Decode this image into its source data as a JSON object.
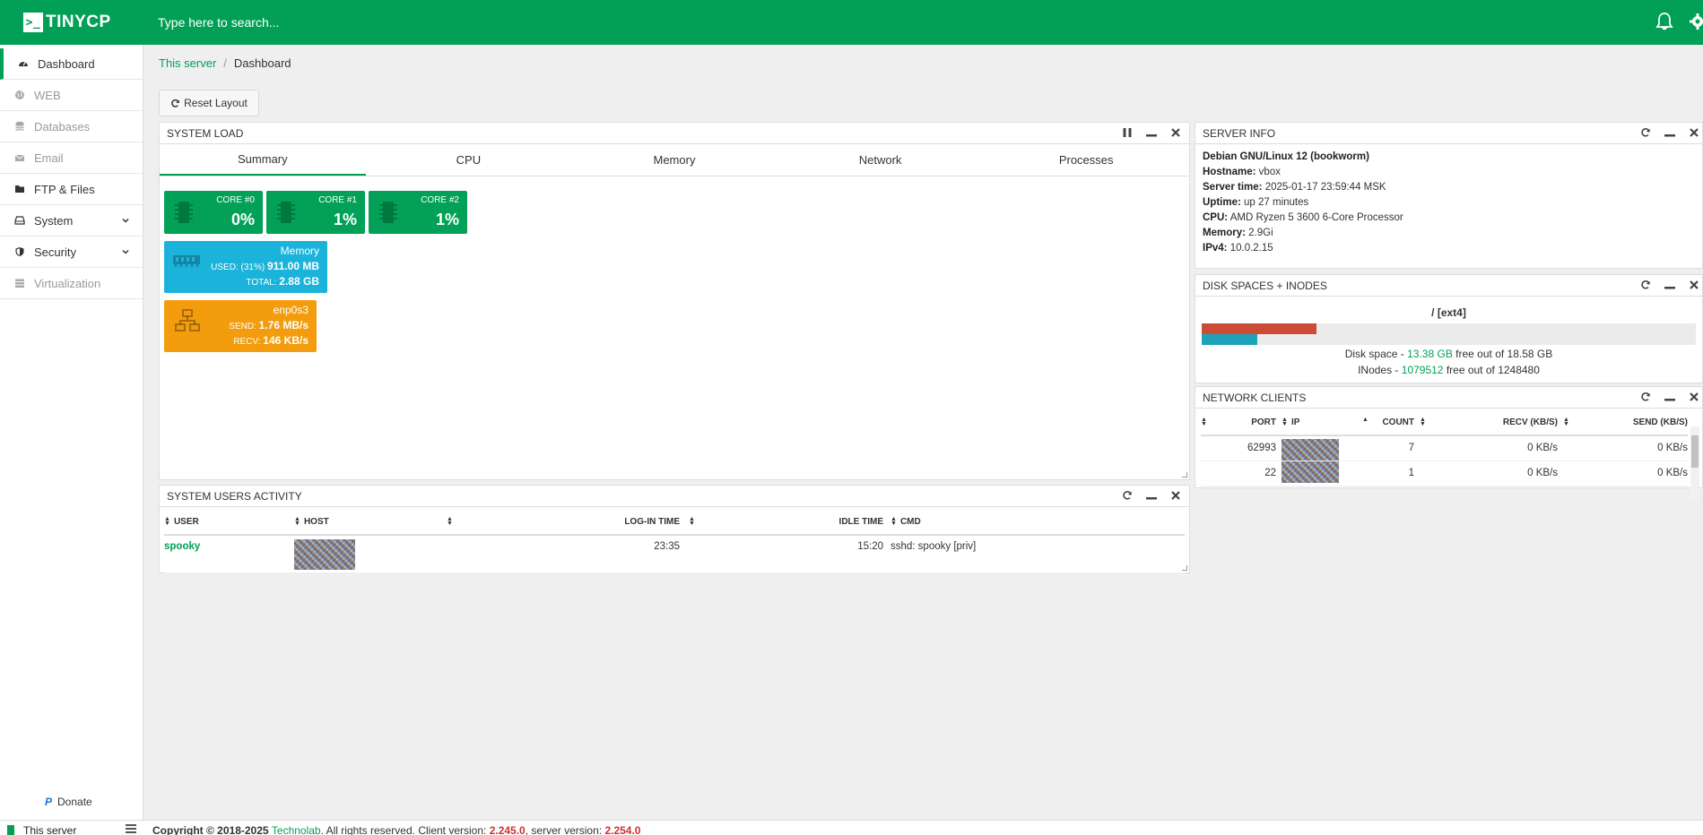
{
  "app": {
    "logo_text": "TINYCP",
    "logo_mark": ">_"
  },
  "search": {
    "placeholder": "Type here to search..."
  },
  "sidebar": {
    "items": [
      {
        "label": "Dashboard",
        "icon": "dashboard-icon",
        "state": "active"
      },
      {
        "label": "WEB",
        "icon": "globe-icon",
        "state": "disabled"
      },
      {
        "label": "Databases",
        "icon": "database-icon",
        "state": "disabled"
      },
      {
        "label": "Email",
        "icon": "envelope-icon",
        "state": "disabled"
      },
      {
        "label": "FTP & Files",
        "icon": "folder-icon",
        "state": "normal"
      },
      {
        "label": "System",
        "icon": "hdd-icon",
        "state": "normal",
        "expandable": true
      },
      {
        "label": "Security",
        "icon": "shield-icon",
        "state": "normal",
        "expandable": true
      },
      {
        "label": "Virtualization",
        "icon": "server-icon",
        "state": "disabled"
      }
    ],
    "donate_label": "Donate"
  },
  "breadcrumb": {
    "root": "This server",
    "separator": "/",
    "current": "Dashboard"
  },
  "toolbar": {
    "reset_label": "Reset Layout"
  },
  "system_load": {
    "title": "SYSTEM LOAD",
    "tabs": [
      "Summary",
      "CPU",
      "Memory",
      "Network",
      "Processes"
    ],
    "active_tab": "Summary",
    "cores": [
      {
        "label": "CORE #0",
        "value": "0%"
      },
      {
        "label": "CORE #1",
        "value": "1%"
      },
      {
        "label": "CORE #2",
        "value": "1%"
      }
    ],
    "memory": {
      "title": "Memory",
      "used_label": "USED: (31%)",
      "used_value": "911.00 MB",
      "total_label": "TOTAL:",
      "total_value": "2.88 GB"
    },
    "network": {
      "title": "enp0s3",
      "send_label": "SEND:",
      "send_value": "1.76 MB/s",
      "recv_label": "RECV:",
      "recv_value": "146 KB/s"
    }
  },
  "server_info": {
    "title": "SERVER INFO",
    "os": "Debian GNU/Linux 12 (bookworm)",
    "rows": [
      {
        "key": "Hostname:",
        "value": "vbox"
      },
      {
        "key": "Server time:",
        "value": "2025-01-17 23:59:44 MSK"
      },
      {
        "key": "Uptime:",
        "value": "up 27 minutes"
      },
      {
        "key": "CPU:",
        "value": "AMD Ryzen 5 3600 6-Core Processor"
      },
      {
        "key": "Memory:",
        "value": "2.9Gi"
      },
      {
        "key": "IPv4:",
        "value": "10.0.2.15"
      }
    ]
  },
  "disk": {
    "title": "DISK SPACES + INODES",
    "mount": "/ [ext4]",
    "space_used_fraction": 0.233,
    "inodes_used_fraction": 0.113,
    "space_color": "#cc4b37",
    "inodes_color": "#1fa2b9",
    "space_prefix": "Disk space - ",
    "space_free": "13.38 GB",
    "space_suffix": " free out of 18.58 GB",
    "inodes_prefix": "INodes - ",
    "inodes_free": "1079512",
    "inodes_suffix": " free out of 1248480"
  },
  "network_clients": {
    "title": "NETWORK CLIENTS",
    "columns": [
      "PORT",
      "IP",
      "COUNT",
      "RECV (KB/S)",
      "SEND (KB/S)"
    ],
    "rows": [
      {
        "port": "62993",
        "count": "7",
        "recv": "0 KB/s",
        "send": "0 KB/s"
      },
      {
        "port": "22",
        "count": "1",
        "recv": "0 KB/s",
        "send": "0 KB/s"
      }
    ]
  },
  "users_activity": {
    "title": "SYSTEM USERS ACTIVITY",
    "columns": [
      "USER",
      "HOST",
      "LOG-IN TIME",
      "IDLE TIME",
      "CMD"
    ],
    "rows": [
      {
        "user": "spooky",
        "login": "23:35",
        "idle": "15:20",
        "cmd": "sshd: spooky [priv]"
      }
    ]
  },
  "footer": {
    "server_name": "This server",
    "copyright_prefix": "Copyright © 2018-2025 ",
    "company": "Technolab",
    "rights": ". All rights reserved. Client version: ",
    "client_version": "2.245.0",
    "server_label": ", server version: ",
    "server_version": "2.254.0"
  },
  "colors": {
    "brand": "#02a057",
    "tile_green": "#03a057",
    "tile_blue": "#1bb3da",
    "tile_orange": "#f29c0e"
  }
}
